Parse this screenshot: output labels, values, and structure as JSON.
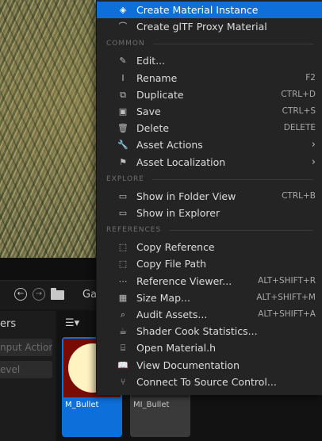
{
  "nav": {
    "breadcrumb": "Ga"
  },
  "left_panel": {
    "title": "ers",
    "filters": [
      "nput Action",
      "evel"
    ]
  },
  "assets": [
    {
      "name": "M_Bullet",
      "selected": true
    },
    {
      "name": "MI_Bullet",
      "selected": false
    }
  ],
  "menu": {
    "top_items": [
      {
        "label": "Create Material Instance",
        "icon": "material-instance-icon",
        "glyph": "◈",
        "highlighted": true
      },
      {
        "label": "Create glTF Proxy Material",
        "icon": "gltf-icon",
        "glyph": "⌒",
        "highlighted": false
      }
    ],
    "sections": [
      {
        "title": "COMMON",
        "items": [
          {
            "label": "Edit...",
            "icon": "pencil-icon",
            "glyph": "✎",
            "shortcut": ""
          },
          {
            "label": "Rename",
            "icon": "rename-icon",
            "glyph": "I",
            "shortcut": "F2"
          },
          {
            "label": "Duplicate",
            "icon": "duplicate-icon",
            "glyph": "⧉",
            "shortcut": "CTRL+D"
          },
          {
            "label": "Save",
            "icon": "save-icon",
            "glyph": "▣",
            "shortcut": "CTRL+S"
          },
          {
            "label": "Delete",
            "icon": "trash-icon",
            "glyph": "🗑",
            "shortcut": "DELETE"
          },
          {
            "label": "Asset Actions",
            "icon": "wrench-icon",
            "glyph": "🔧",
            "shortcut": "",
            "submenu": true
          },
          {
            "label": "Asset Localization",
            "icon": "flag-icon",
            "glyph": "⚑",
            "shortcut": "",
            "submenu": true
          }
        ]
      },
      {
        "title": "EXPLORE",
        "items": [
          {
            "label": "Show in Folder View",
            "icon": "folder-search-icon",
            "glyph": "▭",
            "shortcut": "CTRL+B"
          },
          {
            "label": "Show in Explorer",
            "icon": "folder-search-icon",
            "glyph": "▭",
            "shortcut": ""
          }
        ]
      },
      {
        "title": "REFERENCES",
        "items": [
          {
            "label": "Copy Reference",
            "icon": "copy-reference-icon",
            "glyph": "⬚",
            "shortcut": ""
          },
          {
            "label": "Copy File Path",
            "icon": "copy-path-icon",
            "glyph": "⬚",
            "shortcut": ""
          },
          {
            "label": "Reference Viewer...",
            "icon": "reference-viewer-icon",
            "glyph": "⋯",
            "shortcut": "ALT+SHIFT+R"
          },
          {
            "label": "Size Map...",
            "icon": "size-map-icon",
            "glyph": "▦",
            "shortcut": "ALT+SHIFT+M"
          },
          {
            "label": "Audit Assets...",
            "icon": "audit-icon",
            "glyph": "⌕",
            "shortcut": "ALT+SHIFT+A"
          },
          {
            "label": "Shader Cook Statistics...",
            "icon": "teapot-icon",
            "glyph": "☕",
            "shortcut": ""
          },
          {
            "label": "Open Material.h",
            "icon": "code-file-icon",
            "glyph": "⌸",
            "shortcut": ""
          },
          {
            "label": "View Documentation",
            "icon": "book-icon",
            "glyph": "📖",
            "shortcut": ""
          },
          {
            "label": "Connect To Source Control...",
            "icon": "source-control-icon",
            "glyph": "⑂",
            "shortcut": ""
          }
        ]
      }
    ]
  }
}
